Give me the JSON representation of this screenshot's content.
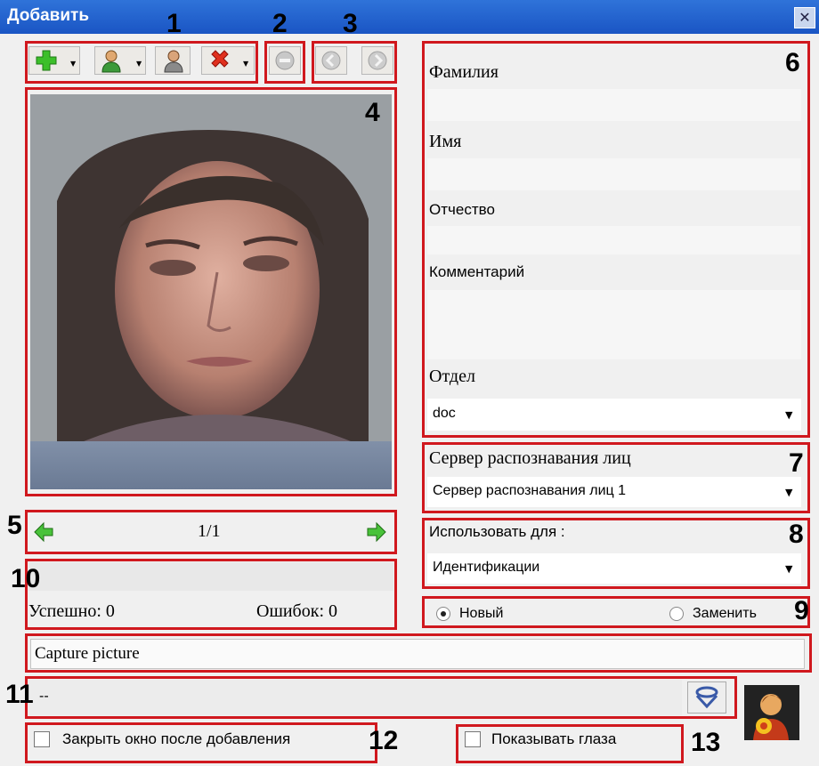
{
  "window": {
    "title": "Добавить",
    "close_icon": "close-icon"
  },
  "callouts": [
    "1",
    "2",
    "3",
    "4",
    "5",
    "6",
    "7",
    "8",
    "9",
    "10",
    "11",
    "12",
    "13"
  ],
  "toolbar": {
    "icons": [
      "add-icon",
      "user-add-icon",
      "user-icon",
      "delete-icon",
      "remove-icon",
      "prev-icon",
      "next-icon"
    ]
  },
  "nav": {
    "page": "1/1"
  },
  "stats": {
    "success": "Успешно: 0",
    "errors": "Ошибок: 0"
  },
  "fields": {
    "surname_label": "Фамилия",
    "name_label": "Имя",
    "patronymic_label": "Отчество",
    "comment_label": "Комментарий",
    "department_label": "Отдел",
    "department_value": "doc",
    "server_label": "Сервер распознавания лиц",
    "server_value": "Сервер распознавания лиц 1",
    "use_label": "Использовать для :",
    "use_value": "Идентификации"
  },
  "mode": {
    "new_label": "Новый",
    "replace_label": "Заменить",
    "selected": "new"
  },
  "capture": {
    "label": "Capture picture"
  },
  "camera": {
    "value": "--"
  },
  "options": {
    "close_after_label": "Закрыть окно после добавления",
    "show_eyes_label": "Показывать глаза"
  },
  "colors": {
    "callout": "#d0181e",
    "title_bar": "#2563d0"
  }
}
